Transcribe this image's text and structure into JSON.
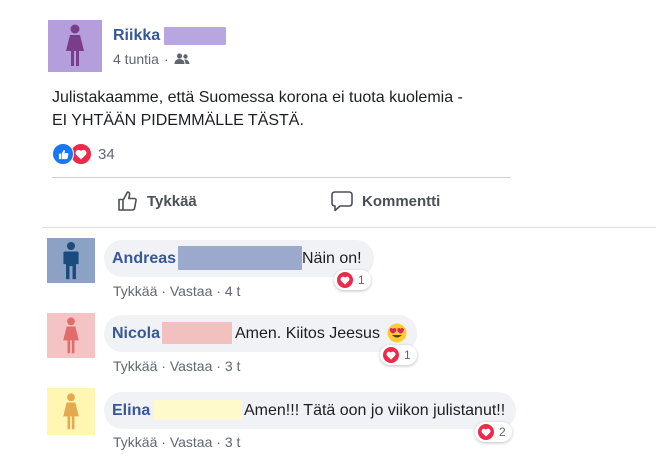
{
  "post": {
    "author": "Riikka",
    "time": "4 tuntia",
    "separator": "·",
    "text_line1": "Julistakaamme, että Suomessa korona ei tuota kuolemia -",
    "text_line2": "EI YHTÄÄN PIDEMMÄLLE TÄSTÄ.",
    "reaction_count": "34",
    "like_label": "Tykkää",
    "comment_label": "Kommentti"
  },
  "comments": [
    {
      "author": "Andreas",
      "text": "Näin on!",
      "like": "Tykkää",
      "dot1": "·",
      "reply": "Vastaa",
      "dot2": "·",
      "time": "4 t",
      "reactions": "1",
      "avatar_color": "#8ba2c5",
      "figure_color": "#1a4c7f",
      "redact_color": "#9ba9cc"
    },
    {
      "author": "Nicola",
      "text": "Amen. Kiitos Jeesus",
      "like": "Tykkää",
      "dot1": "·",
      "reply": "Vastaa",
      "dot2": "·",
      "time": "3 t",
      "reactions": "1",
      "avatar_color": "#f4c4c5",
      "figure_color": "#e26b6c",
      "redact_color": "#f3c0c0"
    },
    {
      "author": "Elina",
      "text": "Amen!!! Tätä oon jo viikon julistanut!!",
      "like": "Tykkää",
      "dot1": "·",
      "reply": "Vastaa",
      "dot2": "·",
      "time": "3 t",
      "reactions": "2",
      "avatar_color": "#fff6b3",
      "figure_color": "#e6a94d",
      "redact_color": "#fffacb"
    }
  ],
  "colors": {
    "post_avatar": "#b49fdc",
    "post_figure": "#7a3d8a",
    "post_redact": "#b8a6e0",
    "link": "#365899",
    "heart": "#f0284a",
    "like_blue": "#1877f2"
  }
}
